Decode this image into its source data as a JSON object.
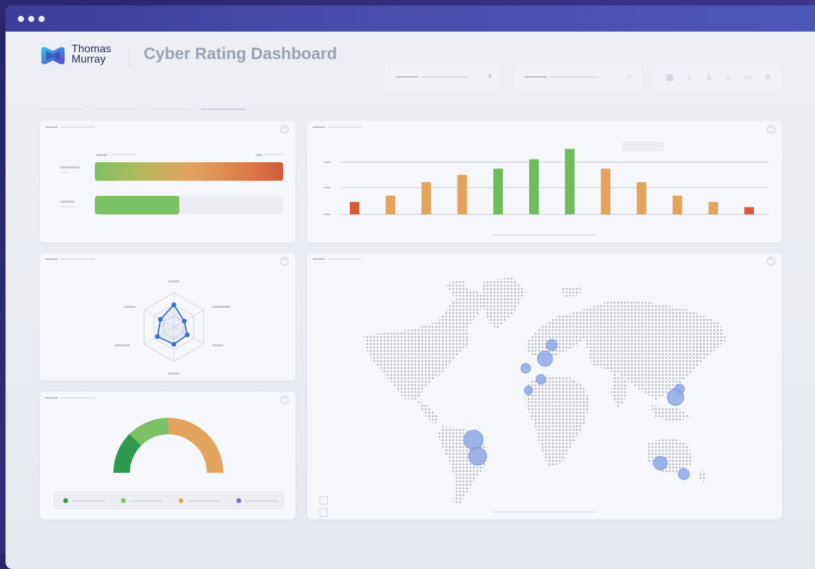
{
  "window": {
    "title_dots": 3
  },
  "header": {
    "brand_line1": "Thomas",
    "brand_line2": "Murray",
    "page_title": "Cyber Rating Dashboard"
  },
  "toolbar": {
    "icons": [
      "grid-icon",
      "search-icon",
      "user-icon",
      "bell-icon",
      "chat-icon",
      "menu-icon"
    ],
    "glyphs": [
      "▦",
      "⌕",
      "♙",
      "○",
      "▭",
      "≡"
    ]
  },
  "cards": {
    "rating_bars": {
      "values": [
        1.0,
        0.45
      ]
    },
    "bar_chart": {
      "chart_data": {
        "type": "bar",
        "values": [
          12,
          18,
          31,
          38,
          44,
          53,
          63,
          44,
          31,
          18,
          12,
          7
        ],
        "colors": [
          "#d65a3b",
          "#e2a45c",
          "#e2a45c",
          "#e2a45c",
          "#6dbd5c",
          "#6dbd5c",
          "#6dbd5c",
          "#e2a45c",
          "#e2a45c",
          "#e2a45c",
          "#e2a45c",
          "#d65a3b"
        ]
      }
    },
    "radar": {
      "chart_data": {
        "type": "radar",
        "axes": 6,
        "values": [
          0.65,
          0.35,
          0.45,
          0.5,
          0.55,
          0.45
        ]
      }
    },
    "gauge": {
      "segments": [
        {
          "color": "#2e9a4d",
          "fraction": 0.25
        },
        {
          "color": "#7cc264",
          "fraction": 0.25
        },
        {
          "color": "#e2a45c",
          "fraction": 0.5
        }
      ],
      "legend_colors": [
        "#2e9a4d",
        "#7cc264",
        "#e2a45c",
        "#7b6cc8"
      ]
    },
    "map": {
      "bubble_color": "#8ea8e6"
    }
  }
}
